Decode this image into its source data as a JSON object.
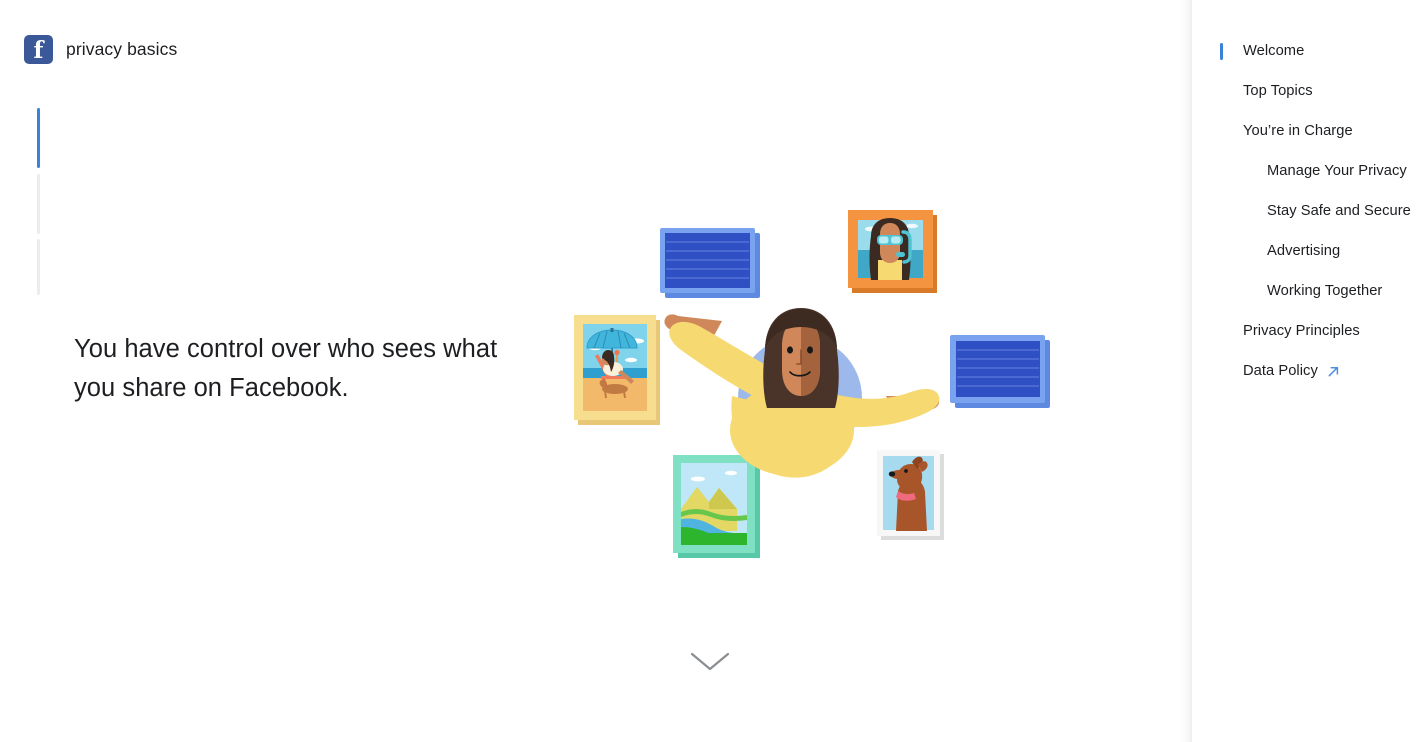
{
  "page": {
    "background_color": "#ffffff",
    "accent_color": "#3b82d9",
    "text_color": "#1c1e21",
    "brand_color": "#3b5998"
  },
  "header": {
    "logo_icon": "facebook-logo-icon",
    "logo_glyph": "f",
    "title": "privacy basics"
  },
  "progress": {
    "steps": [
      {
        "state": "active",
        "color": "#3b82d9"
      },
      {
        "state": "inactive",
        "color": "#ececec"
      },
      {
        "state": "inactive",
        "color": "#ececec"
      }
    ]
  },
  "main": {
    "headline": "You have control over who sees what you share on Facebook.",
    "scroll_hint_icon": "chevron-down-icon"
  },
  "illustration": {
    "name": "person-with-photo-frames-illustration",
    "alt": "A smiling woman with long brown hair and outstretched arms, in a yellow top, on a light blue circle, surrounded by six photo frames.",
    "person": {
      "hair_color": "#4a342a",
      "skin_color": "#d0885a",
      "skin_shade_color": "#a4633c",
      "shirt_color": "#f6d970",
      "halo_color": "#9db8ea"
    },
    "frames": [
      {
        "id": "frame-blue-top-left",
        "label": "Blue placeholder photo",
        "frame_color": "#75a0ef",
        "inner_color": "#2f4fc4",
        "line_color": "#5572d8"
      },
      {
        "id": "frame-snorkel-portrait",
        "label": "Snorkeling selfie",
        "frame_color": "#f59440",
        "inner_sky": "#8ad2e4",
        "inner_sea": "#3fa8c6"
      },
      {
        "id": "frame-beach-photo",
        "label": "Beach day with umbrella and dog",
        "frame_color": "#f7dd8e",
        "inner_sky": "#7fd3ea",
        "inner_sand": "#f2b96b"
      },
      {
        "id": "frame-blue-right",
        "label": "Blue placeholder photo",
        "frame_color": "#75a0ef",
        "inner_color": "#2f4fc4",
        "line_color": "#5572d8"
      },
      {
        "id": "frame-landscape-photo",
        "label": "Mountain and river landscape",
        "frame_color": "#7fe0c4",
        "inner_sky": "#bfe7f7",
        "inner_grass": "#2db52d"
      },
      {
        "id": "frame-dog-photo",
        "label": "Portrait of a brown dog",
        "frame_color": "#f4f4f4",
        "inner_sky": "#a6daef",
        "dog_color": "#a9552a"
      }
    ]
  },
  "sidebar": {
    "items": [
      {
        "label": "Welcome",
        "level": 0,
        "active": true,
        "external": false
      },
      {
        "label": "Top Topics",
        "level": 0,
        "active": false,
        "external": false
      },
      {
        "label": "You’re in Charge",
        "level": 0,
        "active": false,
        "external": false
      },
      {
        "label": "Manage Your Privacy",
        "level": 1,
        "active": false,
        "external": false
      },
      {
        "label": "Stay Safe and Secure",
        "level": 1,
        "active": false,
        "external": false
      },
      {
        "label": "Advertising",
        "level": 1,
        "active": false,
        "external": false
      },
      {
        "label": "Working Together",
        "level": 1,
        "active": false,
        "external": false
      },
      {
        "label": "Privacy Principles",
        "level": 0,
        "active": false,
        "external": false
      },
      {
        "label": "Data Policy",
        "level": 0,
        "active": false,
        "external": true,
        "external_icon": "external-link-icon"
      }
    ]
  }
}
